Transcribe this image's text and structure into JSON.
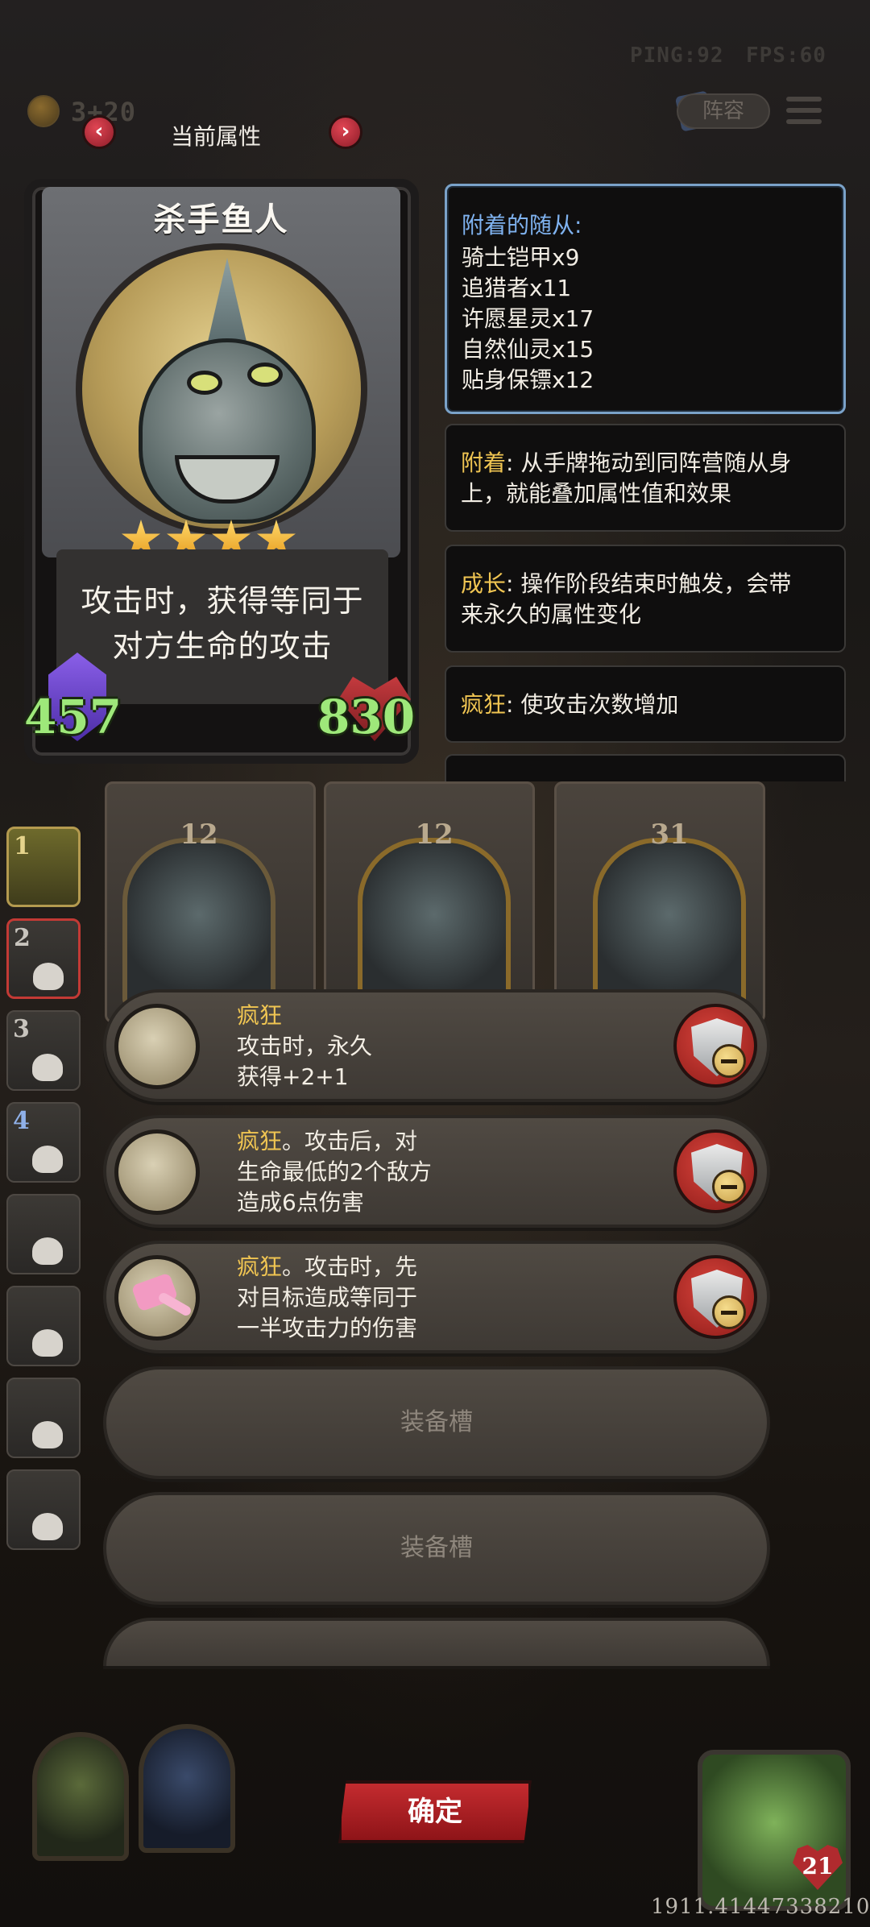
{
  "hud": {
    "ping": "PING:92",
    "fps": "FPS:60",
    "gold": "3+20",
    "lineup_label": "阵容",
    "title": "当前属性",
    "prev_arrow": "‹",
    "next_arrow": "›"
  },
  "hero_card": {
    "name": "杀手鱼人",
    "stars": 4,
    "description_line1": "攻击时，获得等同于",
    "description_line2": "对方生命的攻击",
    "attack": "457",
    "health": "830"
  },
  "attached": {
    "heading": "附着的随从:",
    "items": [
      "骑士铠甲x9",
      "追猎者x11",
      "许愿星灵x17",
      "自然仙灵x15",
      "贴身保镖x12"
    ]
  },
  "keywords": [
    {
      "term": "附着",
      "desc_line1": ": 从手牌拖动到同阵营随从身",
      "desc_line2": "上，就能叠加属性值和效果"
    },
    {
      "term": "成长",
      "desc_line1": ": 操作阶段结束时触发，会带",
      "desc_line2": "来永久的属性变化"
    },
    {
      "term": "疯狂",
      "desc_line1": ": 使攻击次数增加",
      "desc_line2": ""
    }
  ],
  "board_minions": [
    {
      "level": "12"
    },
    {
      "level": "12"
    },
    {
      "level": "31"
    }
  ],
  "party_slots": [
    "1",
    "2",
    "3",
    "4"
  ],
  "equipment": [
    {
      "keyword": "疯狂",
      "line1": "",
      "line2": "攻击时，永久",
      "line3": "获得+2+1",
      "icon": "crossed-swords-icon"
    },
    {
      "keyword": "疯狂",
      "line1": "。攻击后，对",
      "line2": "生命最低的2个敌方",
      "line3": "造成6点伤害",
      "icon": "scythes-icon"
    },
    {
      "keyword": "疯狂",
      "line1": "。攻击时，先",
      "line2": "对目标造成等同于",
      "line3": "一半攻击力的伤害",
      "icon": "pink-hammer-icon"
    }
  ],
  "empty_slot_label": "装备槽",
  "confirm_label": "确定",
  "player_health": "21",
  "coordinates": "1911.41447338210",
  "colors": {
    "keyword_gold": "#f0c552",
    "keyword_blue": "#7fb2ef",
    "stat_green": "#9ee87a",
    "confirm_red": "#c42b2f"
  }
}
